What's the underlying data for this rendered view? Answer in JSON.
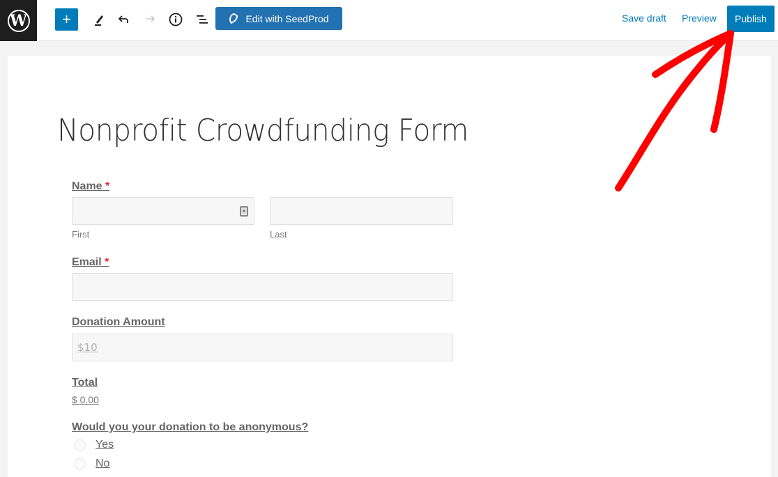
{
  "toolbar": {
    "logo": "W",
    "add_label": "+",
    "edit_icon": "pencil-icon",
    "undo_icon": "↶",
    "redo_icon": "↷",
    "info_icon": "ⓘ",
    "outline_icon": "☰",
    "seedprod_label": "Edit with SeedProd",
    "save_draft_label": "Save draft",
    "preview_label": "Preview",
    "publish_label": "Publish"
  },
  "form": {
    "title": "Nonprofit Crowdfunding Form",
    "name": {
      "label": "Name",
      "required": "*",
      "first_sub": "First",
      "last_sub": "Last",
      "first_value": "",
      "last_value": ""
    },
    "email": {
      "label": "Email",
      "required": "*",
      "value": ""
    },
    "donation": {
      "label": "Donation Amount",
      "placeholder": "$10"
    },
    "total": {
      "label": "Total",
      "value": "$ 0.00"
    },
    "anonymous": {
      "label": "Would you your donation to be anonymous?",
      "options": [
        {
          "label": "Yes",
          "checked": false
        },
        {
          "label": "No",
          "checked": false
        }
      ]
    }
  },
  "annotation": {
    "color": "#ff0000",
    "points_to": "Publish"
  },
  "colors": {
    "accent": "#007cba",
    "seedprod": "#2271b1",
    "dark": "#1e1e1e"
  }
}
